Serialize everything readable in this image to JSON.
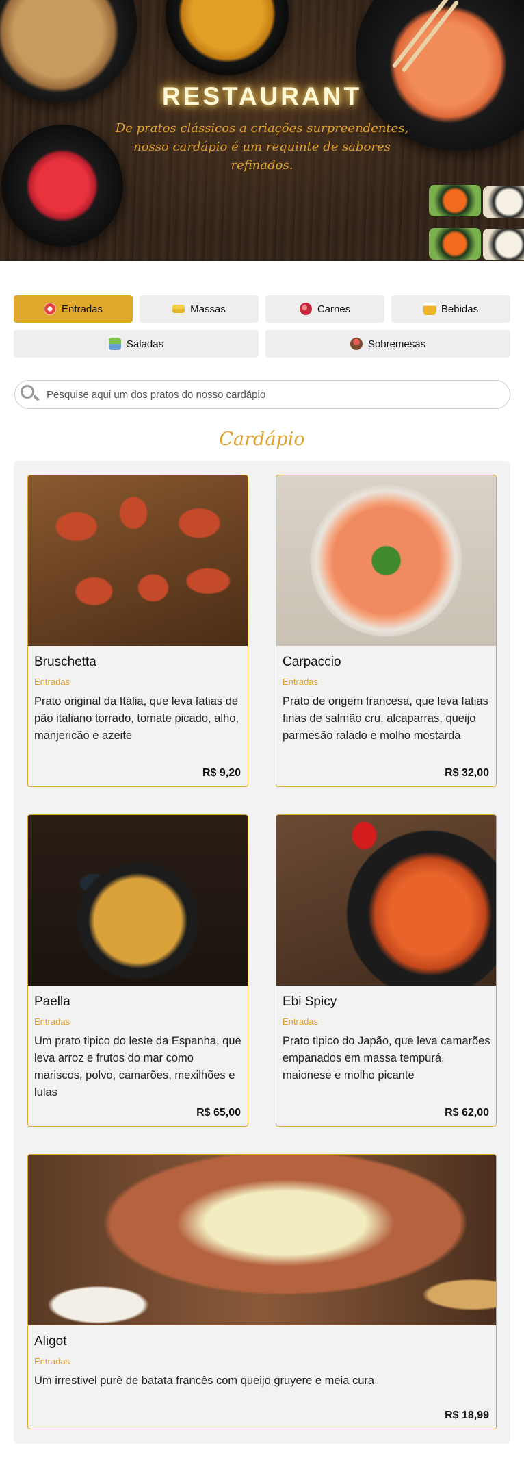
{
  "hero": {
    "title": "RESTAURANT",
    "subtitle": "De pratos clássicos a criações surpreendentes, nosso cardápio é um requinte de sabores refinados."
  },
  "categories": [
    {
      "label": "Entradas",
      "icon": "entradas-icon",
      "active": true
    },
    {
      "label": "Massas",
      "icon": "massas-icon",
      "active": false
    },
    {
      "label": "Carnes",
      "icon": "carnes-icon",
      "active": false
    },
    {
      "label": "Bebidas",
      "icon": "bebidas-icon",
      "active": false
    },
    {
      "label": "Saladas",
      "icon": "saladas-icon",
      "active": false
    },
    {
      "label": "Sobremesas",
      "icon": "sobremesas-icon",
      "active": false
    }
  ],
  "search": {
    "placeholder": "Pesquise aqui um dos pratos do nosso cardápio"
  },
  "menu": {
    "title": "Cardápio",
    "items": [
      {
        "name": "Bruschetta",
        "category": "Entradas",
        "description": "Prato original da Itália, que leva fatias de pão italiano torrado, tomate picado, alho, manjericão e azeite",
        "price": "R$ 9,20"
      },
      {
        "name": "Carpaccio",
        "category": "Entradas",
        "description": "Prato de origem francesa, que leva fatias finas de salmão cru, alcaparras, queijo parmesão ralado e molho mostarda",
        "price": "R$ 32,00"
      },
      {
        "name": "Paella",
        "category": "Entradas",
        "description": "Um prato tipico do leste da Espanha, que leva arroz e frutos do mar como mariscos, polvo, camarões, mexilhões e lulas",
        "price": "R$ 65,00"
      },
      {
        "name": "Ebi Spicy",
        "category": "Entradas",
        "description": "Prato tipico do Japão, que leva camarões empanados em massa tempurá, maionese e molho picante",
        "price": "R$ 62,00"
      },
      {
        "name": "Aligot",
        "category": "Entradas",
        "description": "Um irrestivel purê de batata francês com queijo gruyere e meia cura",
        "price": "R$ 18,99"
      }
    ]
  },
  "colors": {
    "accent": "#e0a82a",
    "accent_text": "#e0a12d",
    "button_bg": "#eeeeee",
    "panel_bg": "#f2f2f2"
  }
}
